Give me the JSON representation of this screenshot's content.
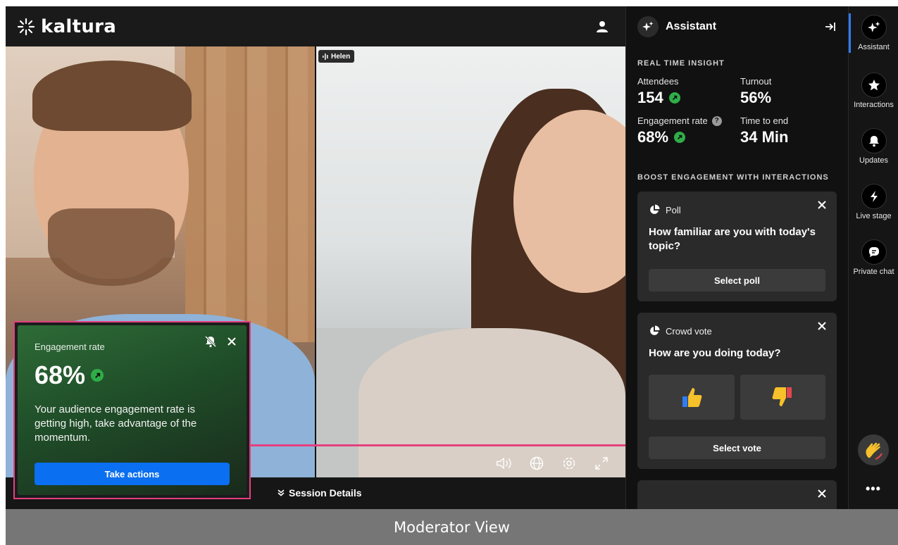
{
  "app": {
    "logo_text": "kaltura"
  },
  "video": {
    "participant_name": "Helen"
  },
  "session": {
    "details_label": "Session Details"
  },
  "popup": {
    "title": "Engagement rate",
    "value": "68%",
    "message": "Your audience engagement rate is getting high, take advantage of the momentum.",
    "action_label": "Take actions"
  },
  "assistant": {
    "title": "Assistant",
    "insight_label": "REAL TIME INSIGHT",
    "stats": {
      "attendees_label": "Attendees",
      "attendees_value": "154",
      "turnout_label": "Turnout",
      "turnout_value": "56%",
      "engagement_label": "Engagement rate",
      "engagement_value": "68%",
      "time_label": "Time to end",
      "time_value": "34 Min"
    },
    "boost_label": "BOOST ENGAGEMENT WITH INTERACTIONS",
    "poll": {
      "type": "Poll",
      "question": "How familiar are you with today's topic?",
      "button": "Select poll"
    },
    "vote": {
      "type": "Crowd vote",
      "question": "How are you doing today?",
      "button": "Select vote"
    }
  },
  "rail": {
    "items": [
      {
        "label": "Assistant",
        "icon": "sparkle-icon"
      },
      {
        "label": "Interactions",
        "icon": "star-icon"
      },
      {
        "label": "Updates",
        "icon": "bell-icon"
      },
      {
        "label": "Live stage",
        "icon": "lightning-icon"
      },
      {
        "label": "Private chat",
        "icon": "chat-icon"
      }
    ],
    "more_label": "•••"
  },
  "caption": {
    "text": "Moderator View"
  },
  "colors": {
    "accent": "#0a6ff0",
    "highlight": "#e4407e",
    "positive": "#2fae48",
    "panel": "#111111",
    "card": "#2a2a2a"
  }
}
